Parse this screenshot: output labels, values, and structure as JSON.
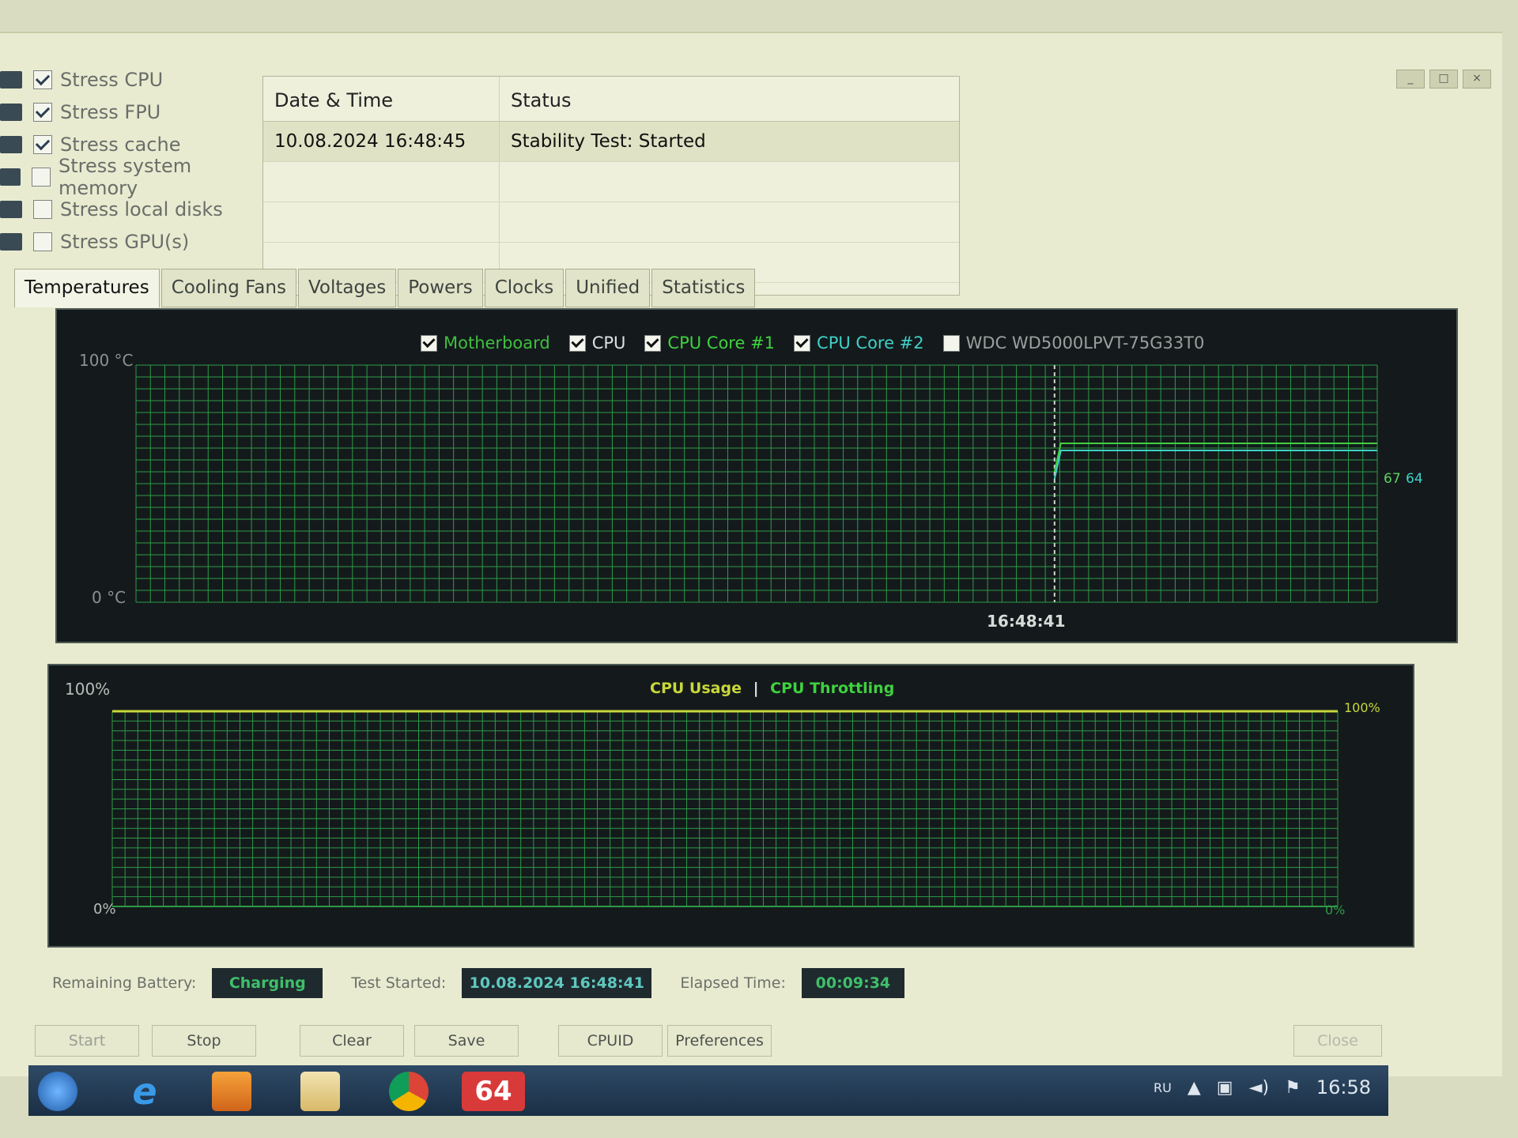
{
  "stress_options": [
    {
      "label": "Stress CPU",
      "checked": true
    },
    {
      "label": "Stress FPU",
      "checked": true
    },
    {
      "label": "Stress cache",
      "checked": true
    },
    {
      "label": "Stress system memory",
      "checked": false
    },
    {
      "label": "Stress local disks",
      "checked": false
    },
    {
      "label": "Stress GPU(s)",
      "checked": false
    }
  ],
  "log": {
    "headers": [
      "Date & Time",
      "Status"
    ],
    "rows": [
      [
        "10.08.2024 16:48:45",
        "Stability Test: Started"
      ]
    ]
  },
  "tabs": [
    "Temperatures",
    "Cooling Fans",
    "Voltages",
    "Powers",
    "Clocks",
    "Unified",
    "Statistics"
  ],
  "temp_graph": {
    "legend": [
      {
        "label": "Motherboard",
        "checked": true,
        "color": "#3fbf3f"
      },
      {
        "label": "CPU",
        "checked": true,
        "color": "#e0e0e0"
      },
      {
        "label": "CPU Core #1",
        "checked": true,
        "color": "#3fd13f"
      },
      {
        "label": "CPU Core #2",
        "checked": true,
        "color": "#3fd1c6"
      },
      {
        "label": "WDC WD5000LPVT-75G33T0",
        "checked": false,
        "color": "#9aa09c"
      }
    ],
    "y_max_label": "100 °C",
    "y_min_label": "0 °C",
    "time_label": "16:48:41",
    "end_value_label": "67",
    "end_value_label_2": "64"
  },
  "usage_graph": {
    "title_usage": "CPU Usage",
    "separator": "|",
    "title_throttling": "CPU Throttling",
    "y_max_label": "100%",
    "y_min_label": "0%",
    "right_max_label": "100%",
    "right_min_label": "0%"
  },
  "status_bar": {
    "battery_label": "Remaining Battery:",
    "battery_value": "Charging",
    "test_started_label": "Test Started:",
    "test_started_value": "10.08.2024 16:48:41",
    "elapsed_label": "Elapsed Time:",
    "elapsed_value": "00:09:34"
  },
  "buttons": {
    "start": "Start",
    "stop": "Stop",
    "clear": "Clear",
    "save": "Save",
    "cpuid": "CPUID",
    "preferences": "Preferences",
    "close": "Close"
  },
  "taskbar": {
    "icons": [
      "windows-start-icon",
      "internet-explorer-icon",
      "media-player-icon",
      "file-explorer-icon",
      "chrome-icon",
      "aida64-icon"
    ],
    "aida_label": "64",
    "language": "RU",
    "clock": "16:58"
  },
  "colors": {
    "grid": "#2e9a46",
    "usage_line": "#c8d83a",
    "temp_line": "#5fd15f",
    "status_text": "#3fbf6a"
  },
  "chart_data": [
    {
      "type": "line",
      "y_range": [
        0,
        100
      ],
      "y_unit": "°C",
      "x_marker": "16:48:41",
      "grid": true,
      "series": [
        {
          "name": "CPU Core #1",
          "values": [
            67,
            67,
            67,
            67,
            67,
            67,
            67,
            67
          ]
        },
        {
          "name": "CPU Core #2",
          "values": [
            64,
            64,
            64,
            64,
            64,
            64,
            64,
            64
          ]
        }
      ]
    },
    {
      "type": "line",
      "y_range": [
        0,
        100
      ],
      "y_unit": "%",
      "grid": true,
      "series": [
        {
          "name": "CPU Usage",
          "values": [
            100,
            100,
            100,
            100,
            100,
            100,
            100,
            100
          ]
        },
        {
          "name": "CPU Throttling",
          "values": [
            0,
            0,
            0,
            0,
            0,
            0,
            0,
            0
          ]
        }
      ]
    }
  ]
}
